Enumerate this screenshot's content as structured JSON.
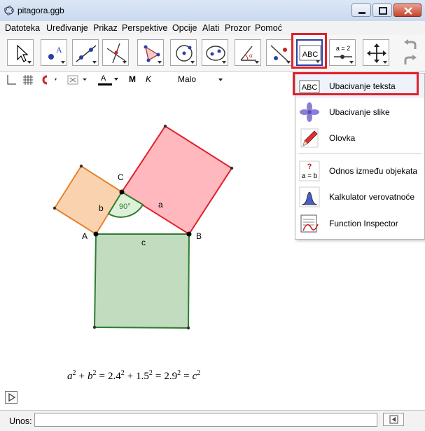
{
  "window": {
    "title": "pitagora.ggb"
  },
  "menu": [
    "Datoteka",
    "Uređivanje",
    "Prikaz",
    "Perspektive",
    "Opcije",
    "Alati",
    "Prozor",
    "Pomoć"
  ],
  "toolbar": {
    "text_tool_label": "ABC",
    "slider_tool_label": "a = 2"
  },
  "stylebar": {
    "bold": "M",
    "italic": "K",
    "font_size": "Malo",
    "text_color_letter": "A"
  },
  "dropdown": {
    "items": [
      {
        "label": "Ubacivanje teksta",
        "icon": "text-abc-icon",
        "selected": true
      },
      {
        "label": "Ubacivanje slike",
        "icon": "image-flower-icon"
      },
      {
        "label": "Olovka",
        "icon": "pen-icon"
      },
      {
        "label": "Odnos između objekata",
        "icon": "relation-icon"
      },
      {
        "label": "Kalkulator verovatnoće",
        "icon": "probability-icon"
      },
      {
        "label": "Function Inspector",
        "icon": "function-inspector-icon"
      }
    ],
    "text_icon_label": "ABC",
    "relation_icon_label": "a = b"
  },
  "figure": {
    "point_labels": [
      "A",
      "B",
      "C"
    ],
    "side_labels": [
      "a",
      "b",
      "c"
    ],
    "angle_label": "90°",
    "colors": {
      "orange_square": "#f9d3b0",
      "red_square": "#ffb8bd",
      "green_square": "#c2dcc0",
      "angle_fill": "#dff0d8"
    },
    "formula": {
      "lhs_a": "a",
      "lhs_b": "b",
      "sq": "2",
      "plus": "+",
      "eq": "=",
      "v1": "2.4",
      "v2": "1.5",
      "v3": "2.9",
      "rhs": "c"
    }
  },
  "input": {
    "label": "Unos:",
    "value": ""
  }
}
